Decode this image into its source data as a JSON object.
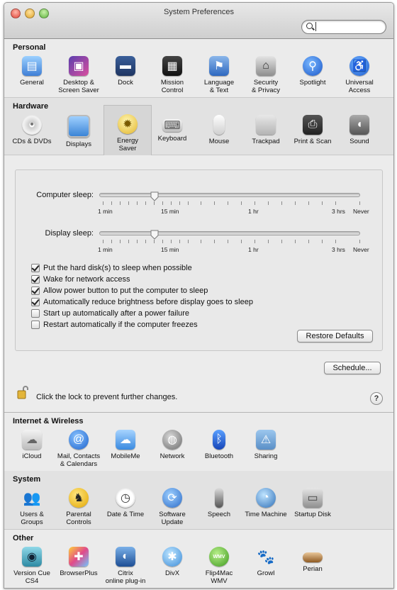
{
  "window": {
    "title": "System Preferences"
  },
  "search": {
    "value": "",
    "placeholder": ""
  },
  "sections": {
    "personal": {
      "title": "Personal",
      "items": [
        {
          "label": "General"
        },
        {
          "label": "Desktop &\nScreen Saver"
        },
        {
          "label": "Dock"
        },
        {
          "label": "Mission\nControl"
        },
        {
          "label": "Language\n& Text"
        },
        {
          "label": "Security\n& Privacy"
        },
        {
          "label": "Spotlight"
        },
        {
          "label": "Universal\nAccess"
        }
      ]
    },
    "hardware": {
      "title": "Hardware",
      "items": [
        {
          "label": "CDs & DVDs"
        },
        {
          "label": "Displays"
        },
        {
          "label": "Energy\nSaver"
        },
        {
          "label": "Keyboard"
        },
        {
          "label": "Mouse"
        },
        {
          "label": "Trackpad"
        },
        {
          "label": "Print & Scan"
        },
        {
          "label": "Sound"
        }
      ]
    },
    "internet": {
      "title": "Internet & Wireless",
      "items": [
        {
          "label": "iCloud"
        },
        {
          "label": "Mail, Contacts\n& Calendars"
        },
        {
          "label": "MobileMe"
        },
        {
          "label": "Network"
        },
        {
          "label": "Bluetooth"
        },
        {
          "label": "Sharing"
        }
      ]
    },
    "system": {
      "title": "System",
      "items": [
        {
          "label": "Users &\nGroups"
        },
        {
          "label": "Parental\nControls"
        },
        {
          "label": "Date & Time"
        },
        {
          "label": "Software\nUpdate"
        },
        {
          "label": "Speech"
        },
        {
          "label": "Time Machine"
        },
        {
          "label": "Startup Disk"
        }
      ]
    },
    "other": {
      "title": "Other",
      "items": [
        {
          "label": "Version Cue\nCS4"
        },
        {
          "label": "BrowserPlus"
        },
        {
          "label": "Citrix\nonline plug-in"
        },
        {
          "label": "DivX"
        },
        {
          "label": "Flip4Mac\nWMV"
        },
        {
          "label": "Growl"
        },
        {
          "label": "Perian"
        }
      ]
    }
  },
  "energy": {
    "computer_sleep": {
      "label": "Computer sleep:",
      "setting": "15 min"
    },
    "display_sleep": {
      "label": "Display sleep:",
      "setting": "15 min"
    },
    "scale_labels": [
      "1 min",
      "15 min",
      "1 hr",
      "3 hrs",
      "Never"
    ],
    "options": [
      {
        "label": "Put the hard disk(s) to sleep when possible",
        "checked": true
      },
      {
        "label": "Wake for network access",
        "checked": true
      },
      {
        "label": "Allow power button to put the computer to sleep",
        "checked": true
      },
      {
        "label": "Automatically reduce brightness before display goes to sleep",
        "checked": true
      },
      {
        "label": "Start up automatically after a power failure",
        "checked": false
      },
      {
        "label": "Restart automatically if the computer freezes",
        "checked": false
      }
    ],
    "restore_defaults": "Restore Defaults",
    "schedule": "Schedule...",
    "lock_text": "Click the lock to prevent further changes.",
    "help": "?"
  },
  "icon_names": {
    "personal": [
      "general-icon",
      "desktop-icon",
      "dock-icon",
      "mission-control-icon",
      "language-icon",
      "security-icon",
      "spotlight-icon",
      "universal-access-icon"
    ],
    "hardware": [
      "cd-icon",
      "display-icon",
      "bulb-icon",
      "keyboard-icon",
      "mouse-icon",
      "trackpad-icon",
      "printer-icon",
      "speaker-icon"
    ],
    "internet": [
      "icloud-icon",
      "mail-icon",
      "mobileme-icon",
      "network-icon",
      "bluetooth-icon",
      "sharing-icon"
    ],
    "system": [
      "users-icon",
      "parental-controls-icon",
      "date-time-icon",
      "software-update-icon",
      "microphone-icon",
      "time-machine-icon",
      "startup-disk-icon"
    ],
    "other": [
      "version-cue-icon",
      "browserplus-icon",
      "citrix-icon",
      "divx-icon",
      "flip4mac-icon",
      "growl-icon",
      "perian-icon"
    ]
  },
  "colors": {
    "accent": "#2f6fd6",
    "window_bg": "#ededed",
    "selected_pane": "#d6d6d6"
  }
}
